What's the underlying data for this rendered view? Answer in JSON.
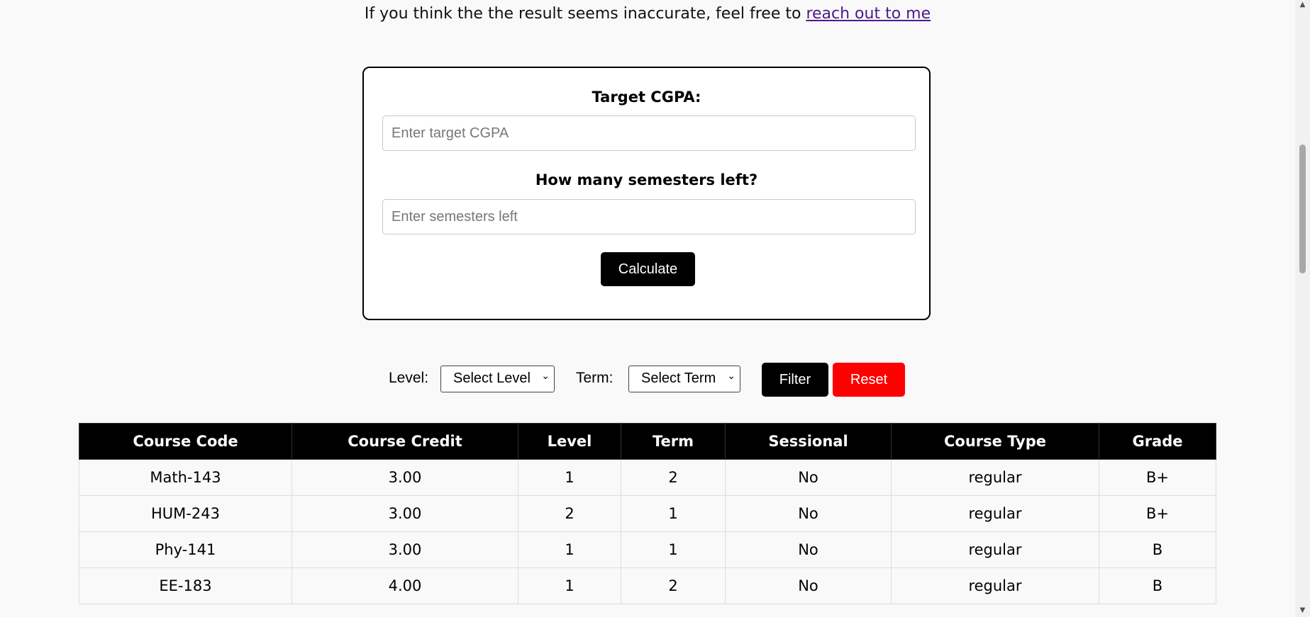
{
  "notice": {
    "text": "If you think the the result seems inaccurate, feel free to ",
    "link_text": "reach out to me"
  },
  "target_form": {
    "target_label": "Target CGPA:",
    "target_placeholder": "Enter target CGPA",
    "target_value": "",
    "semesters_label": "How many semesters left?",
    "semesters_placeholder": "Enter semesters left",
    "semesters_value": "",
    "calculate_label": "Calculate"
  },
  "filter": {
    "level_label": "Level:",
    "level_selected": "Select Level",
    "term_label": "Term:",
    "term_selected": "Select Term",
    "filter_label": "Filter",
    "reset_label": "Reset"
  },
  "colors": {
    "accent": "#000000",
    "reset": "#ff0000",
    "link": "#4b1a8a"
  },
  "table": {
    "headers": [
      "Course Code",
      "Course Credit",
      "Level",
      "Term",
      "Sessional",
      "Course Type",
      "Grade"
    ],
    "rows": [
      [
        "Math-143",
        "3.00",
        "1",
        "2",
        "No",
        "regular",
        "B+"
      ],
      [
        "HUM-243",
        "3.00",
        "2",
        "1",
        "No",
        "regular",
        "B+"
      ],
      [
        "Phy-141",
        "3.00",
        "1",
        "1",
        "No",
        "regular",
        "B"
      ],
      [
        "EE-183",
        "4.00",
        "1",
        "2",
        "No",
        "regular",
        "B"
      ]
    ]
  }
}
